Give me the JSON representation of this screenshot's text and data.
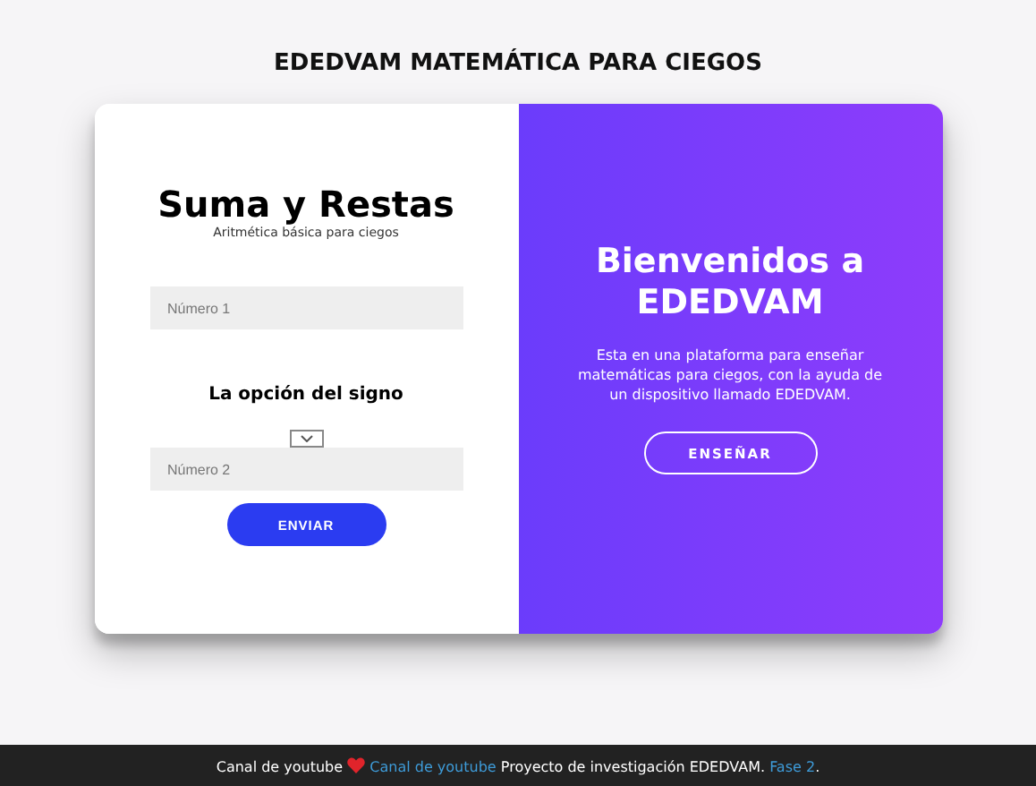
{
  "page_title": "EDEDVAM MATEMÁTICA PARA CIEGOS",
  "form": {
    "title": "Suma y Restas",
    "subtitle": "Aritmética básica para ciegos",
    "first_field": {
      "placeholder": "Número 1"
    },
    "sign_label": "La opción del signo",
    "second_field": {
      "placeholder": "Número 2"
    },
    "submit": "ENVIAR"
  },
  "welcome": {
    "title": "Bienvenidos a EDEDVAM",
    "text": "Esta en una plataforma para enseñar matemáticas para ciegos, con la ayuda de un dispositivo llamado EDEDVAM.",
    "button": "ENSEÑAR"
  },
  "footer": [
    {
      "kind": "text",
      "text": "Canal de youtube"
    },
    {
      "kind": "heart"
    },
    {
      "kind": "link",
      "text": "Canal de youtube"
    },
    {
      "kind": "text",
      "text": "Proyecto de investigación EDEDVAM."
    },
    {
      "kind": "link",
      "text": "Fase 2"
    },
    {
      "kind": "punct",
      "text": "."
    }
  ]
}
